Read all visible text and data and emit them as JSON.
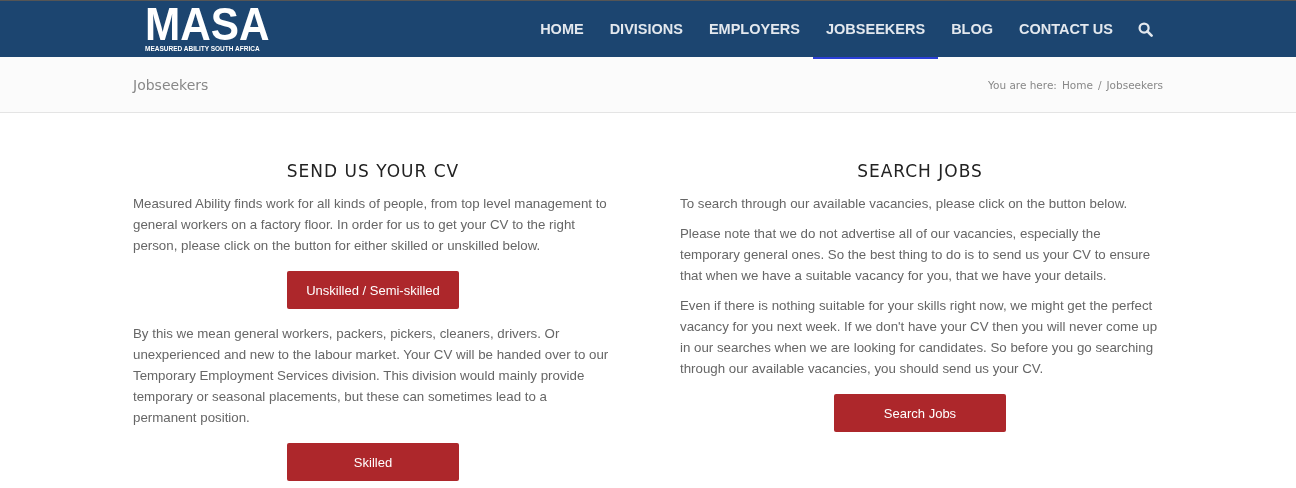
{
  "header": {
    "logo": {
      "title": "MASA",
      "subtitle": "MEASURED ABILITY SOUTH AFRICA"
    },
    "nav": [
      {
        "label": "HOME",
        "selected": false
      },
      {
        "label": "DIVISIONS",
        "selected": false
      },
      {
        "label": "EMPLOYERS",
        "selected": false
      },
      {
        "label": "JOBSEEKERS",
        "selected": true
      },
      {
        "label": "BLOG",
        "selected": false
      },
      {
        "label": "CONTACT US",
        "selected": false
      }
    ]
  },
  "title_bar": {
    "title": "Jobseekers",
    "breadcrumb": {
      "prefix": "You are here:",
      "separator": "/",
      "items": [
        "Home",
        "Jobseekers"
      ]
    }
  },
  "columns": [
    {
      "heading": "SEND US YOUR CV",
      "blocks": [
        {
          "kind": "paragraph",
          "text": "Measured Ability finds work for all kinds of people, from top level management to general workers on a factory floor. In order for us to get your CV to the right person, please click on the button for either skilled or unskilled below."
        },
        {
          "kind": "button",
          "text": "Unskilled / Semi-skilled"
        },
        {
          "kind": "paragraph",
          "text": "By this we mean general workers, packers, pickers, cleaners, drivers. Or unexperienced and new to the labour market. Your CV will be handed over to our Temporary Employment Services division. This division would mainly provide temporary or seasonal placements, but these can sometimes lead to a permanent position."
        },
        {
          "kind": "button",
          "text": "Skilled"
        }
      ]
    },
    {
      "heading": "SEARCH JOBS",
      "blocks": [
        {
          "kind": "paragraph",
          "text": "To search through our available vacancies, please click on the button below."
        },
        {
          "kind": "paragraph",
          "text": "Please note that we do not advertise all of our vacancies, especially the temporary general ones. So the best thing to do is to send us your CV to ensure that when we have a suitable vacancy for you, that we have your details."
        },
        {
          "kind": "paragraph",
          "text": "Even if there is nothing suitable for your skills right now, we might get the perfect vacancy for you next week. If we don't have your CV then you will never come up in our searches when we are looking for candidates. So before you go searching through our available vacancies, you should send us your CV."
        },
        {
          "kind": "button",
          "text": "Search Jobs"
        }
      ]
    }
  ]
}
